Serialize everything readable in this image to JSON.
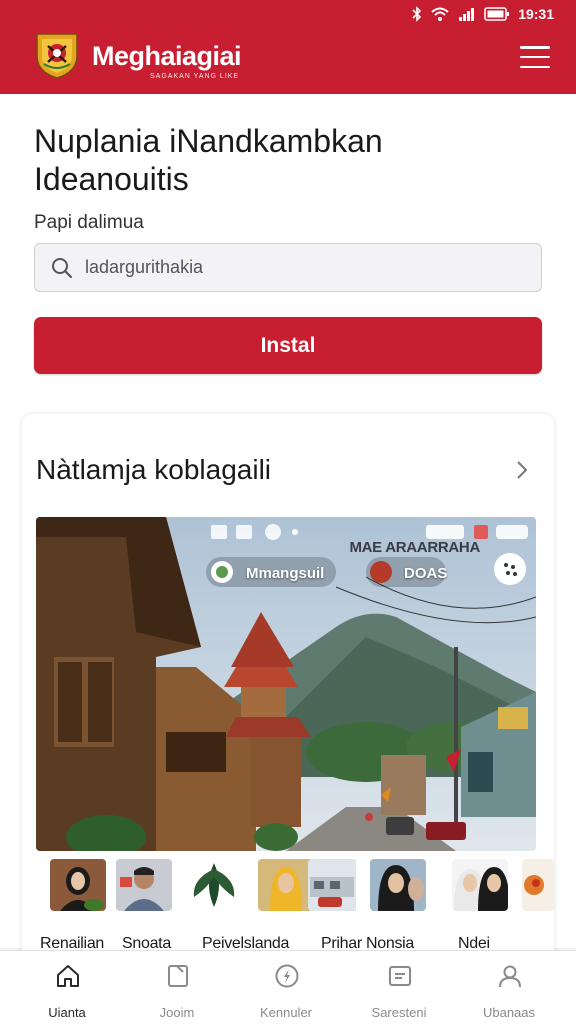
{
  "status_bar": {
    "time": "19:31"
  },
  "header": {
    "app_name": "Meghaiagiai",
    "tagline": "SAGAKAN YANG LIKE"
  },
  "main": {
    "title": "Nuplania iNandkambkan Ideanouitis",
    "field_label": "Papi dalimua",
    "search_placeholder": "ladargurithakia",
    "install_button": "Instal"
  },
  "card": {
    "title": "Nàtlamja koblagaili",
    "hero": {
      "overlay_title": "MAE ARAARRAHA",
      "chip_left": "Mmangsuil",
      "chip_right": "DOAS"
    },
    "thumbnails": [
      {
        "label": "Renailian"
      },
      {
        "label": "Snoata"
      },
      {
        "label": "Peivelslanda"
      },
      {
        "label": "Prihar Nonsia"
      },
      {
        "label": "Ndei"
      }
    ]
  },
  "bottom_nav": [
    {
      "label": "Uianta",
      "icon": "home-icon",
      "active": true
    },
    {
      "label": "Jooim",
      "icon": "document-icon",
      "active": false
    },
    {
      "label": "Kennuler",
      "icon": "compass-icon",
      "active": false
    },
    {
      "label": "Saresteni",
      "icon": "message-icon",
      "active": false
    },
    {
      "label": "Ubanaas",
      "icon": "profile-icon",
      "active": false
    }
  ],
  "colors": {
    "brand_red": "#c81e32",
    "background": "#ffffff"
  }
}
